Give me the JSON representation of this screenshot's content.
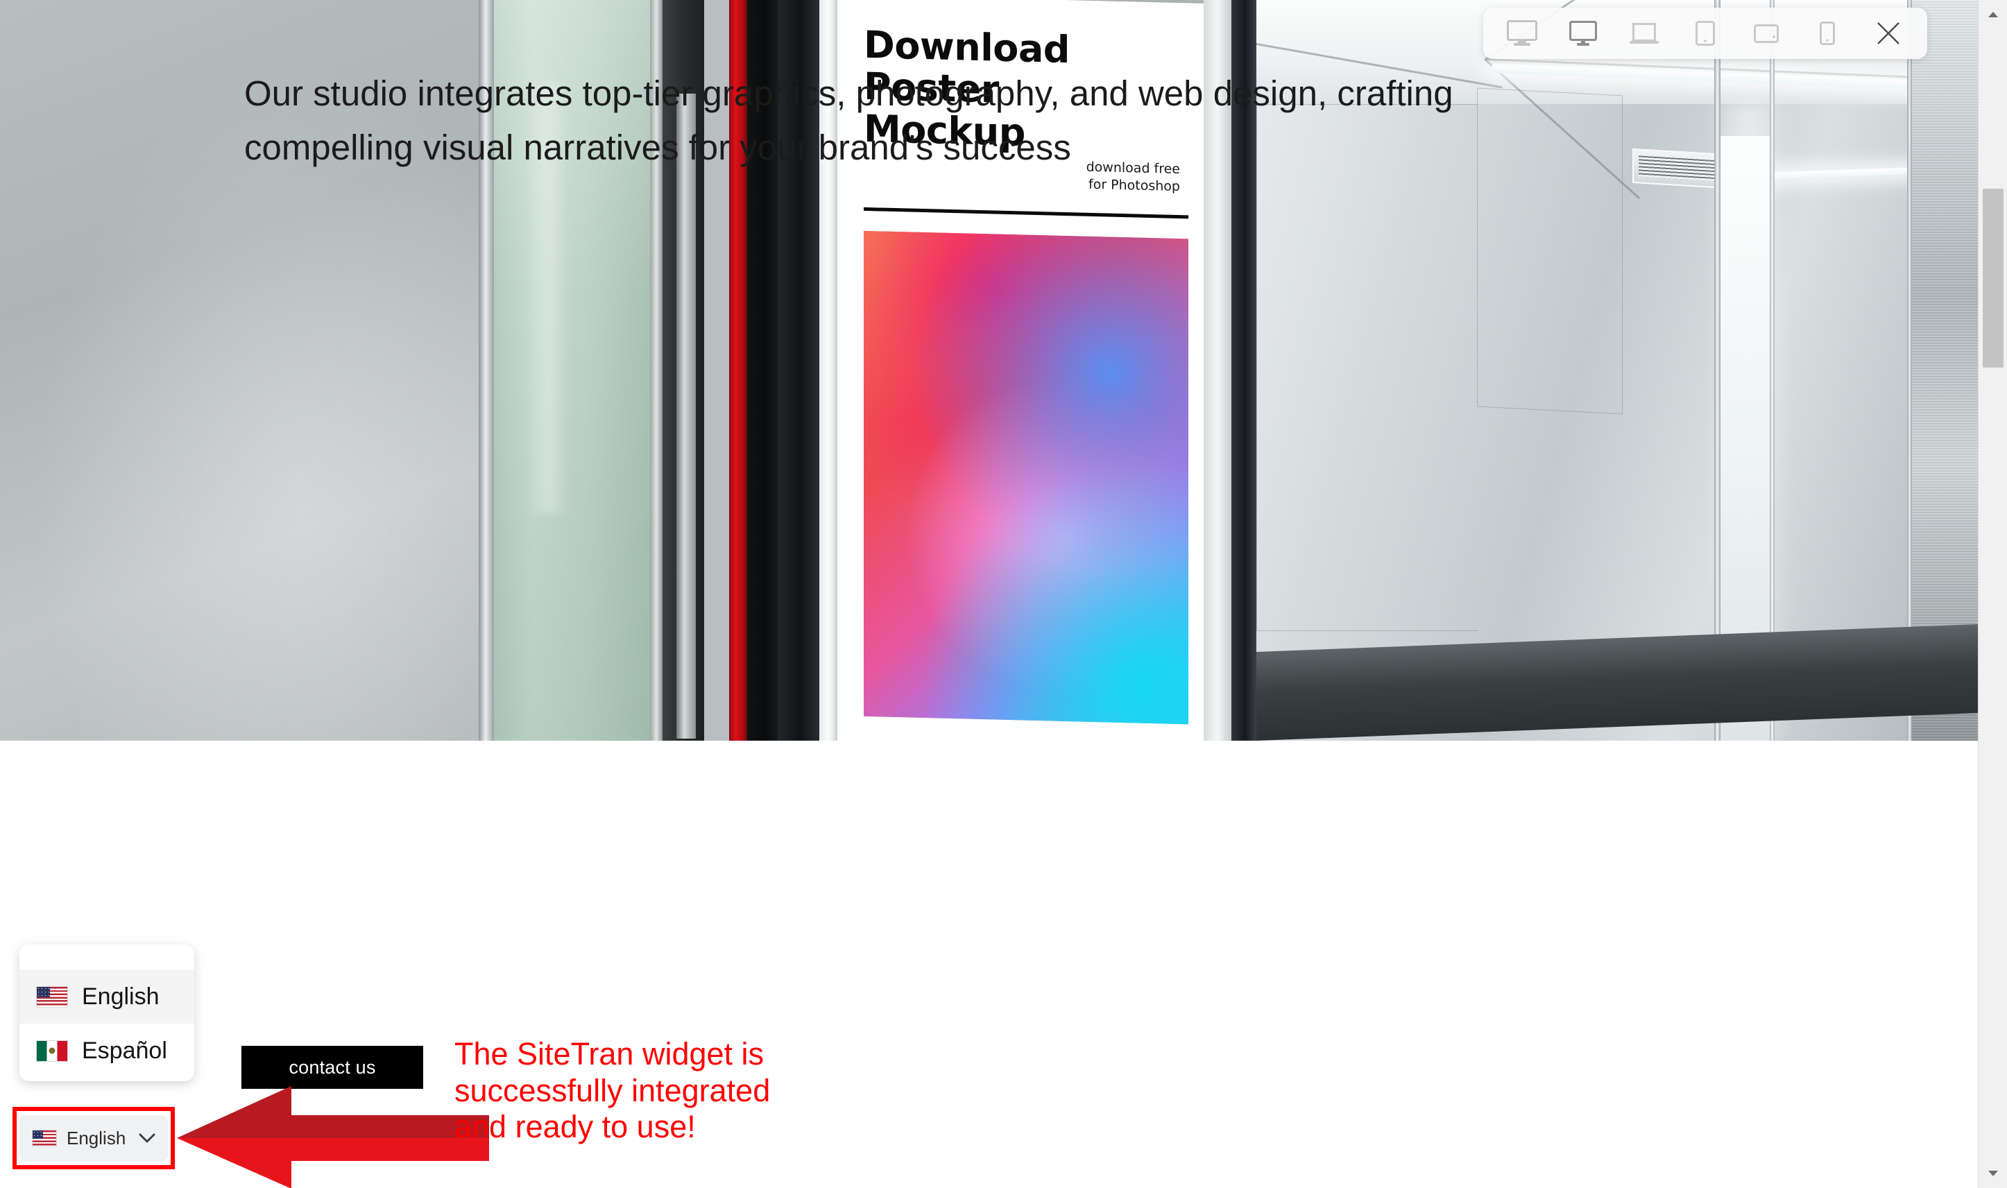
{
  "device_toolbar": {
    "buttons": [
      {
        "name": "desktop-large",
        "label": "Desktop Large"
      },
      {
        "name": "desktop",
        "label": "Desktop"
      },
      {
        "name": "laptop",
        "label": "Laptop"
      },
      {
        "name": "tablet-portrait",
        "label": "Tablet Portrait"
      },
      {
        "name": "tablet-landscape",
        "label": "Tablet Landscape"
      },
      {
        "name": "mobile",
        "label": "Mobile"
      },
      {
        "name": "close",
        "label": "Close"
      }
    ],
    "active": "desktop"
  },
  "hero": {
    "poster": {
      "title_line1": "Download",
      "title_line2": "Poster",
      "title_line3": "Mockup",
      "sub_line1": "download free",
      "sub_line2": "for Photoshop"
    }
  },
  "content": {
    "body_text": "Our studio integrates top-tier graphics, photography, and web design, crafting compelling visual narratives for your brand's success",
    "contact_button": "contact us"
  },
  "annotation": {
    "text": "The SiteTran widget is\nsuccessfully integrated\nand ready to use!",
    "color": "#ff0000",
    "arrow_direction": "left"
  },
  "language_widget": {
    "options": [
      {
        "label": "English",
        "flag": "us-flag-icon",
        "selected": true
      },
      {
        "label": "Español",
        "flag": "mx-flag-icon",
        "selected": false
      }
    ],
    "selected_label": "English",
    "selected_flag": "us-flag-icon",
    "chevron": "chevron-down-icon"
  },
  "colors": {
    "annotation_red": "#ff0000",
    "contact_bg": "#000000",
    "highlight_border": "#ff0000"
  }
}
